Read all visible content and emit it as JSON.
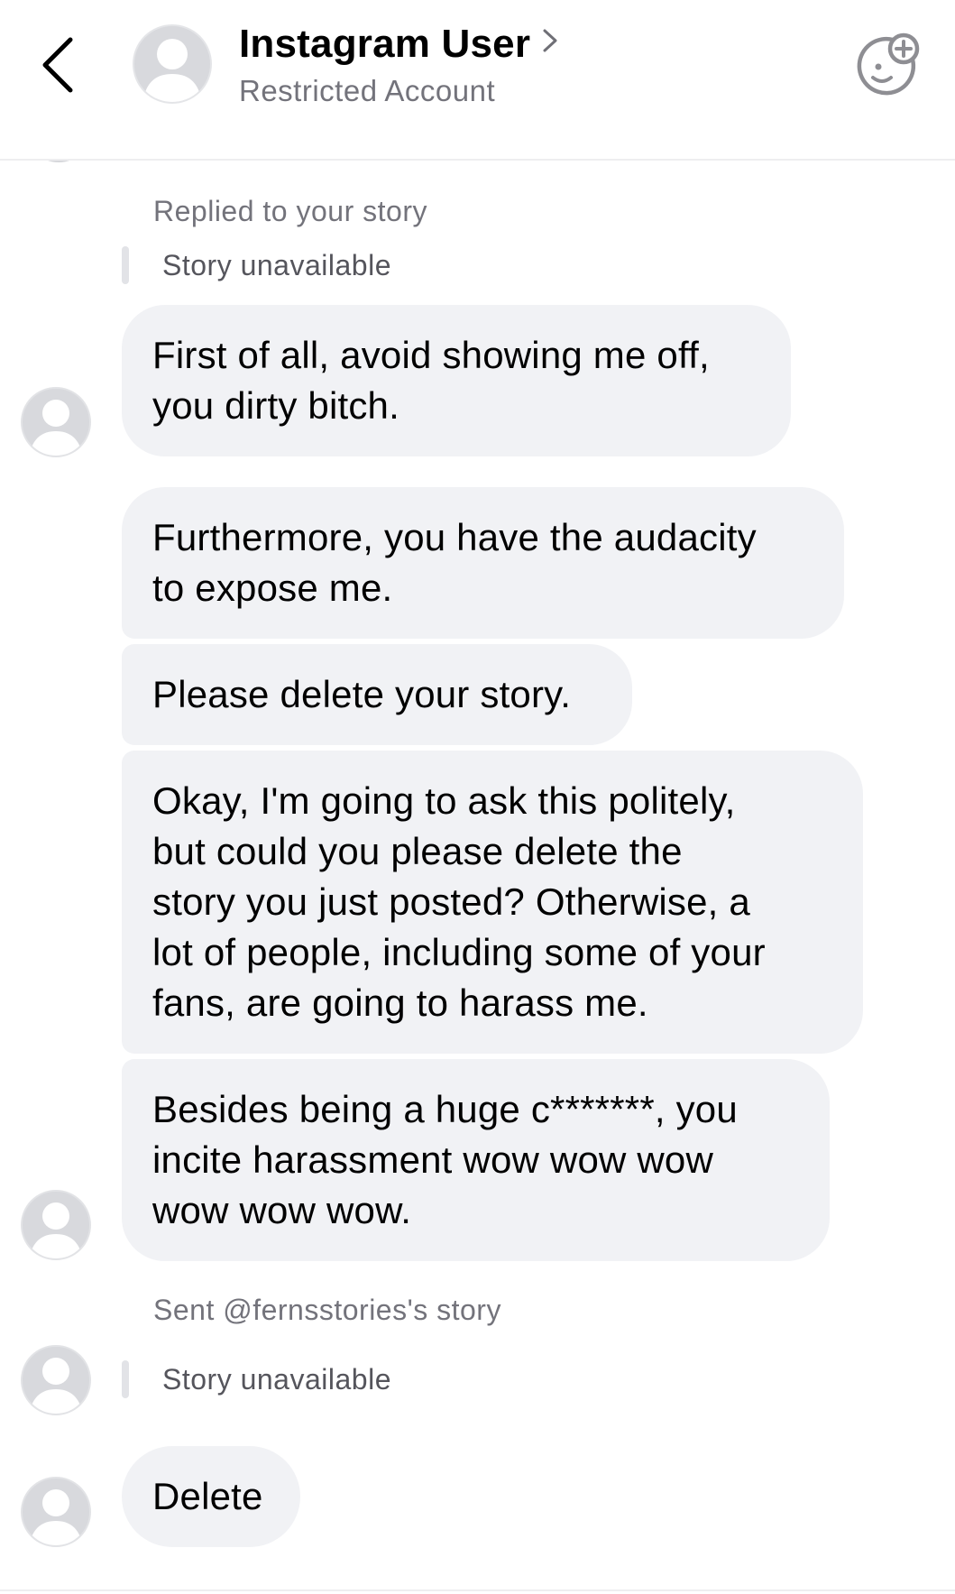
{
  "header": {
    "title": "Instagram User",
    "subtitle": "Restricted Account",
    "back_icon": "chevron-left-icon",
    "title_chevron_icon": "chevron-right-icon",
    "action_icon": "add-effect-icon"
  },
  "thread": {
    "story_reply": {
      "label": "Replied to your story",
      "story_text": "Story unavailable"
    },
    "messages": [
      {
        "lines": [
          "First of all, avoid showing me off,",
          "you dirty bitch."
        ]
      },
      {
        "lines": [
          "Furthermore, you have the audacity",
          "to expose me."
        ]
      },
      {
        "lines": [
          "Please delete your story."
        ]
      },
      {
        "lines": [
          "Okay, I'm going to ask this politely,",
          "but could you please delete the",
          "story you just posted? Otherwise, a",
          "lot of people, including some of your",
          "fans, are going to harass me."
        ]
      },
      {
        "lines": [
          "Besides being a huge c*******, you",
          "incite harassment wow wow wow",
          "wow wow wow."
        ]
      }
    ],
    "shared_story": {
      "label": "Sent @fernsstories's story",
      "story_text": "Story unavailable"
    },
    "last_message": {
      "text": "Delete"
    }
  },
  "colors": {
    "bubble_bg": "#f1f2f5",
    "secondary_text": "#73737b",
    "divider": "#eeeef0"
  }
}
